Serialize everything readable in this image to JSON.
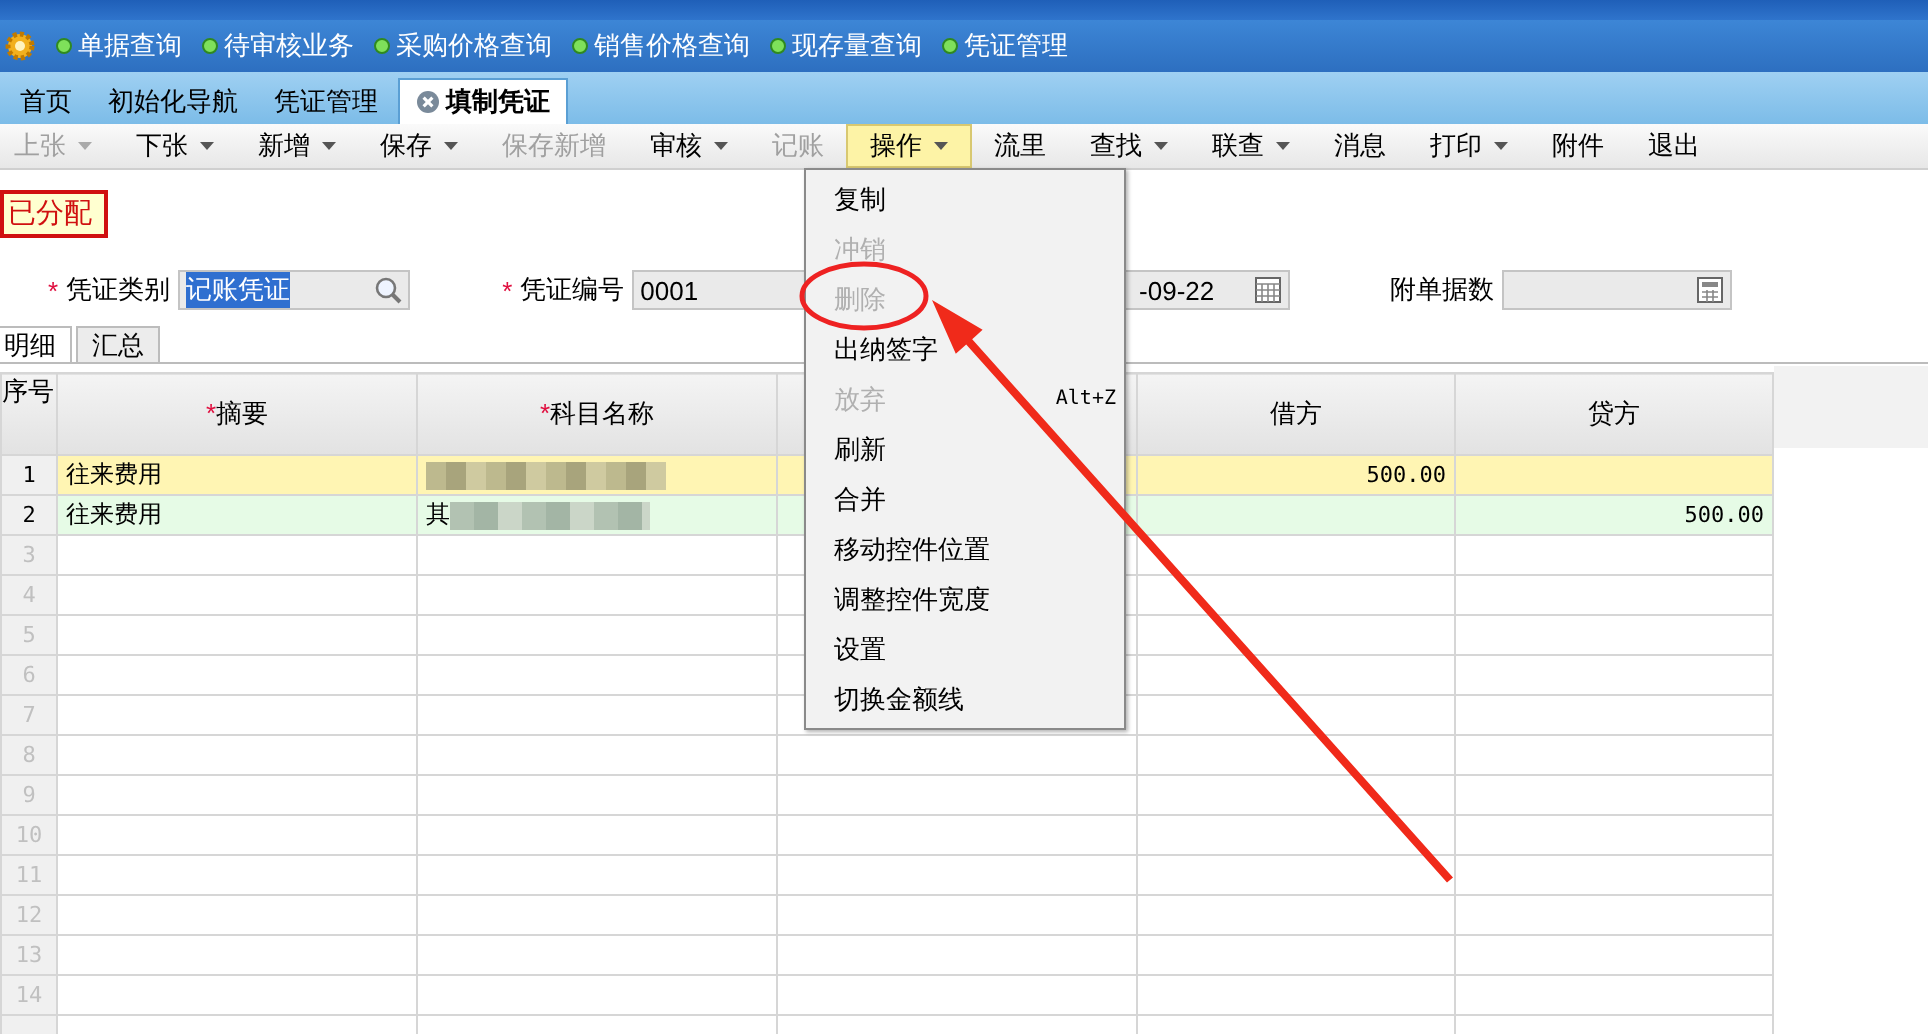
{
  "quick_bar": {
    "items": [
      {
        "label": "单据查询"
      },
      {
        "label": "待审核业务"
      },
      {
        "label": "采购价格查询"
      },
      {
        "label": "销售价格查询"
      },
      {
        "label": "现存量查询"
      },
      {
        "label": "凭证管理"
      }
    ]
  },
  "tabs": [
    {
      "label": "首页",
      "selected": false,
      "closable": false
    },
    {
      "label": "初始化导航",
      "selected": false,
      "closable": false
    },
    {
      "label": "凭证管理",
      "selected": false,
      "closable": false
    },
    {
      "label": "填制凭证",
      "selected": true,
      "closable": true
    }
  ],
  "toolbar": [
    {
      "label": "上张",
      "disabled": true,
      "dropdown": true,
      "open": false
    },
    {
      "label": "下张",
      "disabled": false,
      "dropdown": true,
      "open": false
    },
    {
      "label": "新增",
      "disabled": false,
      "dropdown": true,
      "open": false
    },
    {
      "label": "保存",
      "disabled": false,
      "dropdown": true,
      "open": false
    },
    {
      "label": "保存新增",
      "disabled": true,
      "dropdown": false,
      "open": false
    },
    {
      "label": "审核",
      "disabled": false,
      "dropdown": true,
      "open": false
    },
    {
      "label": "记账",
      "disabled": true,
      "dropdown": false,
      "open": false
    },
    {
      "label": "操作",
      "disabled": false,
      "dropdown": true,
      "open": true
    },
    {
      "label": "流里",
      "disabled": false,
      "dropdown": false,
      "open": false
    },
    {
      "label": "查找",
      "disabled": false,
      "dropdown": true,
      "open": false
    },
    {
      "label": "联查",
      "disabled": false,
      "dropdown": true,
      "open": false
    },
    {
      "label": "消息",
      "disabled": false,
      "dropdown": false,
      "open": false
    },
    {
      "label": "打印",
      "disabled": false,
      "dropdown": true,
      "open": false
    },
    {
      "label": "附件",
      "disabled": false,
      "dropdown": false,
      "open": false
    },
    {
      "label": "退出",
      "disabled": false,
      "dropdown": false,
      "open": false
    }
  ],
  "status_badge": "已分配",
  "form": [
    {
      "required_mark": "*",
      "label": "凭证类别",
      "value": "记账凭证",
      "value_selected": true
    },
    {
      "required_mark": "*",
      "label": "凭证编号",
      "value": "0001",
      "value_selected": false
    },
    {
      "value": "-09-22",
      "value_selected": false
    },
    {
      "label": "附单据数"
    }
  ],
  "sub_tabs": [
    {
      "label": "明细",
      "selected": true
    },
    {
      "label": "汇总",
      "selected": false
    }
  ],
  "table": {
    "columns": [
      {
        "label": "序号"
      },
      {
        "required_mark": "*",
        "label": "摘要"
      },
      {
        "required_mark": "*",
        "label": "科目名称"
      },
      {},
      {
        "label": "借方"
      },
      {
        "label": "贷方"
      }
    ],
    "rows": [
      {
        "seq": "1",
        "selected": true,
        "filled": true,
        "cells": [
          "往来费用",
          "",
          "",
          "500.00",
          ""
        ],
        "blurred": [
          false,
          true,
          false,
          false,
          false
        ]
      },
      {
        "seq": "2",
        "selected": false,
        "filled": true,
        "cells": [
          "往来费用",
          "其",
          "",
          "",
          "500.00"
        ],
        "blurred": [
          false,
          true,
          false,
          false,
          false
        ]
      },
      {
        "seq": "3",
        "selected": false,
        "filled": false
      },
      {
        "seq": "4",
        "selected": false,
        "filled": false
      },
      {
        "seq": "5",
        "selected": false,
        "filled": false
      },
      {
        "seq": "6",
        "selected": false,
        "filled": false
      },
      {
        "seq": "7",
        "selected": false,
        "filled": false
      },
      {
        "seq": "8",
        "selected": false,
        "filled": false
      },
      {
        "seq": "9",
        "selected": false,
        "filled": false
      },
      {
        "seq": "10",
        "selected": false,
        "filled": false
      },
      {
        "seq": "11",
        "selected": false,
        "filled": false
      },
      {
        "seq": "12",
        "selected": false,
        "filled": false
      },
      {
        "seq": "13",
        "selected": false,
        "filled": false
      },
      {
        "seq": "14",
        "selected": false,
        "filled": false
      },
      {
        "selected": false,
        "filled": false
      }
    ]
  },
  "context_menu": {
    "items": [
      {
        "label": "复制",
        "disabled": false,
        "circled": false
      },
      {
        "label": "冲销",
        "disabled": true,
        "circled": false
      },
      {
        "label": "删除",
        "disabled": true,
        "circled": true
      },
      {
        "label": "出纳签字",
        "disabled": false,
        "circled": false
      },
      {
        "label": "放弃",
        "disabled": true,
        "circled": false,
        "shortcut": "Alt+Z"
      },
      {
        "label": "刷新",
        "disabled": false,
        "circled": false
      },
      {
        "label": "合并",
        "disabled": false,
        "circled": false
      },
      {
        "label": "移动控件位置",
        "disabled": false,
        "circled": false
      },
      {
        "label": "调整控件宽度",
        "disabled": false,
        "circled": false
      },
      {
        "label": "设置",
        "disabled": false,
        "circled": false
      },
      {
        "label": "切换金额线",
        "disabled": false,
        "circled": false
      }
    ]
  }
}
